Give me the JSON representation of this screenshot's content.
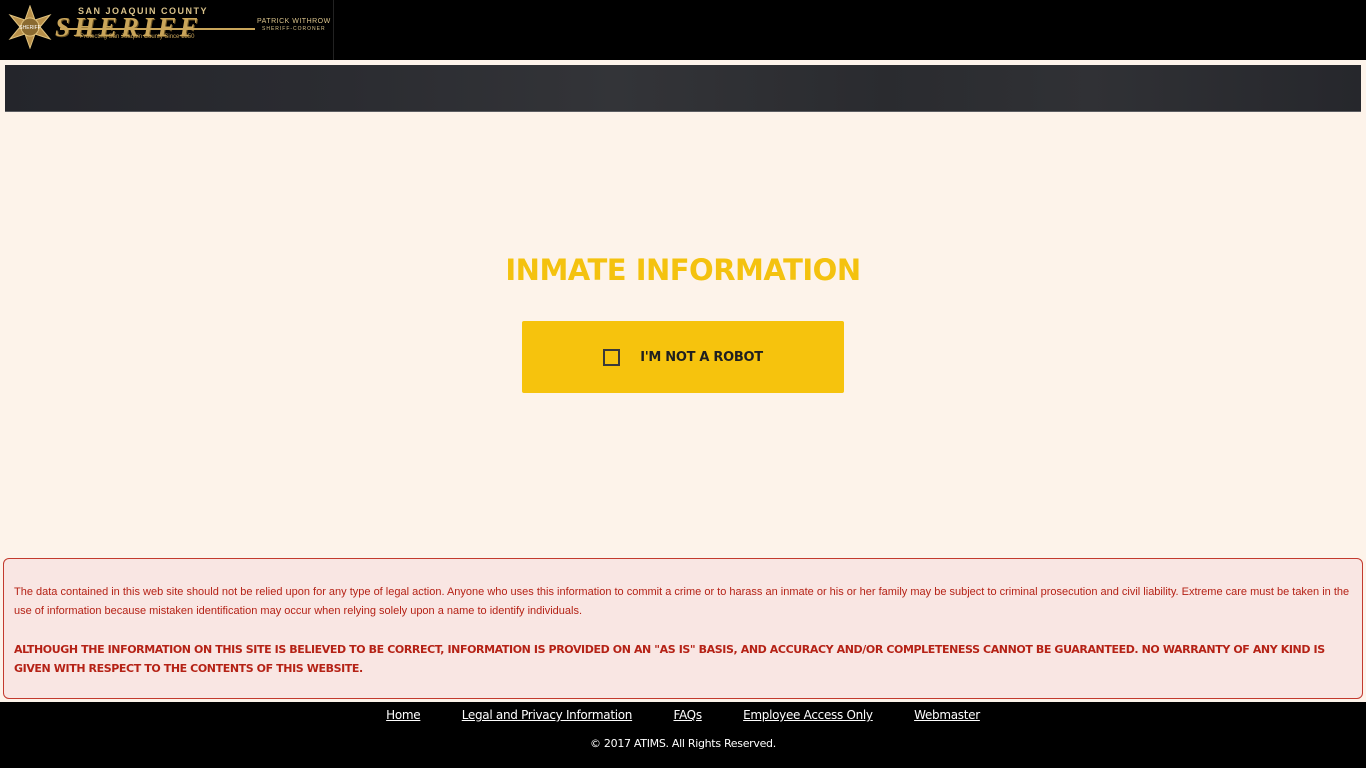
{
  "header": {
    "logo": {
      "county": "SAN JOAQUIN COUNTY",
      "title": "SHERIFF",
      "tagline": "Protecting San Joaquin County Since 1850",
      "sheriff_name": "PATRICK WITHROW",
      "sheriff_role": "SHERIFF-CORONER",
      "badge_text": "SHERIFF"
    }
  },
  "main": {
    "heading": "INMATE INFORMATION",
    "captcha_label": "I'M NOT A ROBOT"
  },
  "disclaimer": {
    "text": "The data contained in this web site should not be relied upon for any type of legal action. Anyone who uses this information to commit a crime or to harass an inmate or his or her family may be subject to criminal prosecution and civil liability. Extreme care must be taken in the use of information because mistaken identification may occur when relying solely upon a name to identify individuals.",
    "warning": "ALTHOUGH THE INFORMATION ON THIS SITE IS BELIEVED TO BE CORRECT, INFORMATION IS PROVIDED ON AN \"AS IS\" BASIS, AND ACCURACY AND/OR COMPLETENESS CANNOT BE GUARANTEED. NO WARRANTY OF ANY KIND IS GIVEN WITH RESPECT TO THE CONTENTS OF THIS WEBSITE."
  },
  "footer": {
    "links": [
      "Home",
      "Legal and Privacy Information",
      "FAQs",
      "Employee Access Only",
      "Webmaster"
    ],
    "copyright": "© 2017 ATIMS. All Rights Reserved."
  },
  "colors": {
    "accent_yellow": "#f6c30d",
    "heading_yellow": "#f4c20f",
    "disclaimer_red": "#b52216",
    "background": "#fdf3ea"
  }
}
